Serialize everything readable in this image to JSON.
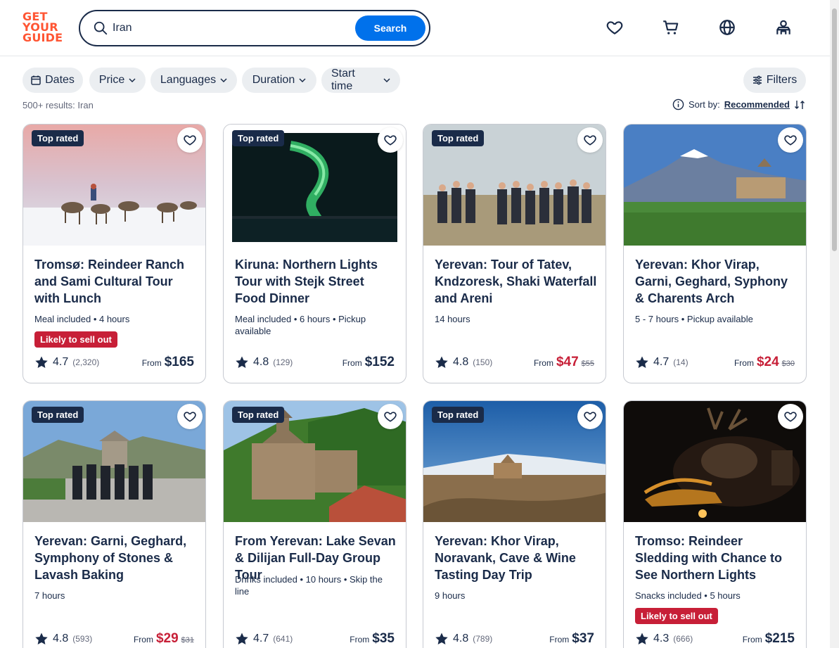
{
  "logo": {
    "line1": "GET",
    "line2": "YOUR",
    "line3": "GUIDE",
    "color": "#ff5533"
  },
  "search": {
    "value": "Iran",
    "button": "Search"
  },
  "header_icons": [
    "heart-icon",
    "cart-icon",
    "globe-icon",
    "profile-icon"
  ],
  "filters": {
    "dates": "Dates",
    "price": "Price",
    "languages": "Languages",
    "duration": "Duration",
    "start_time": "Start time",
    "more": "Filters"
  },
  "results": {
    "text": "500+ results: Iran",
    "sort_label": "Sort by:",
    "sort_value": "Recommended"
  },
  "cards": [
    {
      "badge": "Top rated",
      "title": "Tromsø: Reindeer Ranch and Sami Cultural Tour with Lunch",
      "meta": "Meal included • 4 hours",
      "sell": "Likely to sell out",
      "rating": "4.7",
      "count": "(2,320)",
      "from": "From",
      "price": "$165",
      "old": ""
    },
    {
      "badge": "Top rated",
      "title": "Kiruna: Northern Lights Tour with Stejk Street Food Dinner",
      "meta": "Meal included • 6 hours • Pickup available",
      "sell": "",
      "rating": "4.8",
      "count": "(129)",
      "from": "From",
      "price": "$152",
      "old": ""
    },
    {
      "badge": "Top rated",
      "title": "Yerevan: Tour of Tatev, Kndzoresk, Shaki Waterfall and Areni",
      "meta": "14 hours",
      "sell": "",
      "rating": "4.8",
      "count": "(150)",
      "from": "From",
      "price": "$47",
      "old": "$55"
    },
    {
      "badge": "",
      "title": "Yerevan: Khor Virap, Garni, Geghard, Syphony & Charents Arch",
      "meta": "5 - 7 hours • Pickup available",
      "sell": "",
      "rating": "4.7",
      "count": "(14)",
      "from": "From",
      "price": "$24",
      "old": "$30"
    },
    {
      "badge": "Top rated",
      "title": "Yerevan: Garni, Geghard, Symphony of Stones & Lavash Baking",
      "meta": "7 hours",
      "sell": "",
      "rating": "4.8",
      "count": "(593)",
      "from": "From",
      "price": "$29",
      "old": "$31"
    },
    {
      "badge": "Top rated",
      "title": "From Yerevan: Lake Sevan & Dilijan Full-Day Group Tour",
      "meta": "Drinks included • 10 hours • Skip the line",
      "sell": "",
      "rating": "4.7",
      "count": "(641)",
      "from": "From",
      "price": "$35",
      "old": ""
    },
    {
      "badge": "Top rated",
      "title": "Yerevan: Khor Virap, Noravank, Cave & Wine Tasting Day Trip",
      "meta": "9 hours",
      "sell": "",
      "rating": "4.8",
      "count": "(789)",
      "from": "From",
      "price": "$37",
      "old": ""
    },
    {
      "badge": "",
      "title": "Tromso: Reindeer Sledding with Chance to See Northern Lights",
      "meta": "Snacks included • 5 hours",
      "sell": "Likely to sell out",
      "rating": "4.3",
      "count": "(666)",
      "from": "From",
      "price": "$215",
      "old": ""
    }
  ],
  "colors": {
    "brand_blue": "#0071eb",
    "sale_red": "#c71f37",
    "navy": "#1a2b49"
  }
}
